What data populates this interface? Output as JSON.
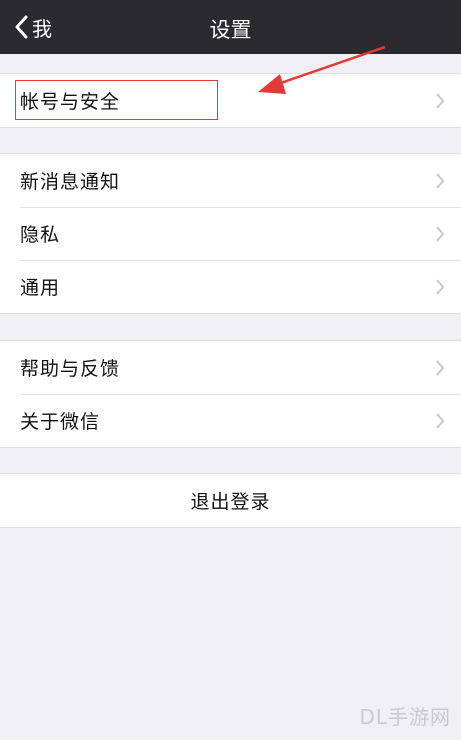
{
  "navbar": {
    "back_label": "我",
    "title": "设置"
  },
  "groups": [
    {
      "items": [
        {
          "label": "帐号与安全"
        }
      ]
    },
    {
      "items": [
        {
          "label": "新消息通知"
        },
        {
          "label": "隐私"
        },
        {
          "label": "通用"
        }
      ]
    },
    {
      "items": [
        {
          "label": "帮助与反馈"
        },
        {
          "label": "关于微信"
        }
      ]
    }
  ],
  "logout": {
    "label": "退出登录"
  },
  "annotation": {
    "color": "#e53935"
  },
  "watermark": "DL手游网"
}
